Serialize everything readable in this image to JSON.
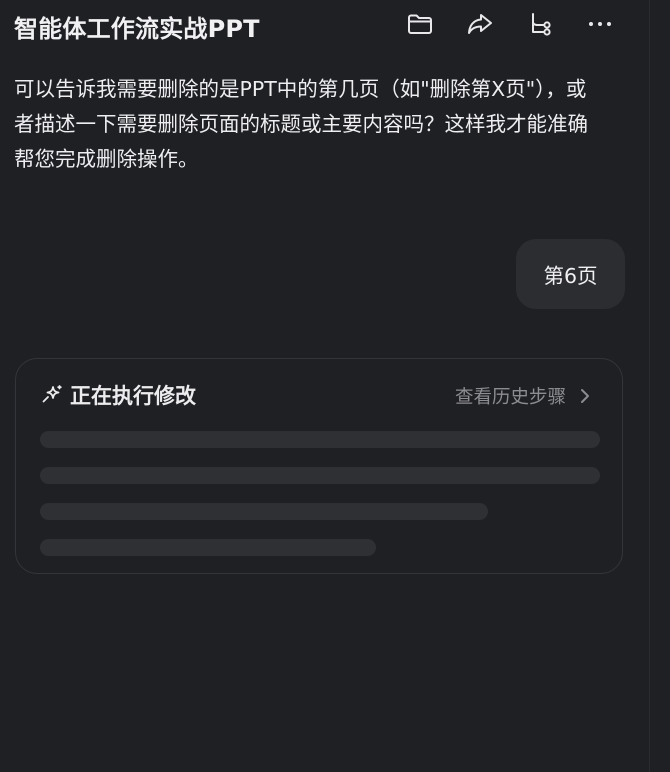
{
  "header": {
    "title": "智能体工作流实战PPT",
    "icons": [
      "folder-icon",
      "share-icon",
      "branch-icon",
      "more-icon"
    ]
  },
  "messages": {
    "assistant_text": "可以告诉我需要删除的是PPT中的第几页（如\"删除第X页\"），或者描述一下需要删除页面的标题或主要内容吗？这样我才能准确帮您完成删除操作。",
    "user_text": "第6页"
  },
  "task_card": {
    "status_label": "正在执行修改",
    "history_link": "查看历史步骤",
    "icon": "sparkle-icon",
    "skeleton_lines": 4
  },
  "colors": {
    "background": "#1f2023",
    "bubble": "#2c2d31",
    "skeleton": "#2f3034",
    "muted_text": "#8c8d92"
  }
}
